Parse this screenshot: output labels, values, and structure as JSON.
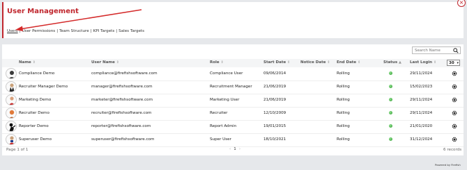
{
  "page": {
    "title": "User Management",
    "close_icon": "close-icon"
  },
  "nav": {
    "links": [
      "Users",
      "User Permissions",
      "Team Structure",
      "KPI Targets",
      "Sales Targets"
    ],
    "active": "Users"
  },
  "search": {
    "placeholder": "Search Name",
    "value": ""
  },
  "table": {
    "columns": [
      "Name",
      "User Name",
      "Role",
      "Start Date",
      "Notice Date",
      "End Date",
      "Status",
      "Last Login"
    ],
    "page_size": "30",
    "rows": [
      {
        "name": "Compliance Demo",
        "user_name": "compliance@firefishsoftware.com",
        "role": "Compliance User",
        "start_date": "09/06/2014",
        "notice_date": "",
        "end_date": "Rolling",
        "status": "active",
        "last_login": "29/11/2024"
      },
      {
        "name": "Recruiter Manager Demo",
        "user_name": "manager@firefishsoftware.com",
        "role": "Recruitment Manager",
        "start_date": "21/06/2019",
        "notice_date": "",
        "end_date": "Rolling",
        "status": "active",
        "last_login": "15/02/2023"
      },
      {
        "name": "Marketing Demo",
        "user_name": "marketer@firefishsoftware.com",
        "role": "Marketing User",
        "start_date": "21/06/2019",
        "notice_date": "",
        "end_date": "Rolling",
        "status": "active",
        "last_login": "29/11/2024"
      },
      {
        "name": "Recruiter Demo",
        "user_name": "recruiter@firefishsoftware.com",
        "role": "Recruiter",
        "start_date": "12/10/2009",
        "notice_date": "",
        "end_date": "Rolling",
        "status": "active",
        "last_login": "29/11/2024"
      },
      {
        "name": "Reporter Demo",
        "user_name": "reporter@firefishsoftware.com",
        "role": "Report Admin",
        "start_date": "19/01/2015",
        "notice_date": "",
        "end_date": "Rolling",
        "status": "active",
        "last_login": "21/01/2020"
      },
      {
        "name": "Superuser Demo",
        "user_name": "superuser@firefishsoftware.com",
        "role": "Super User",
        "start_date": "18/10/2021",
        "notice_date": "",
        "end_date": "Rolling",
        "status": "active",
        "last_login": "31/12/2024"
      }
    ]
  },
  "footer": {
    "page_info": "Page 1 of 1",
    "current_page": "1",
    "record_count": "6 records",
    "powered_by": "Powered by Firefish"
  },
  "colors": {
    "accent": "#c0262d",
    "status_active": "#2d9b2d"
  }
}
